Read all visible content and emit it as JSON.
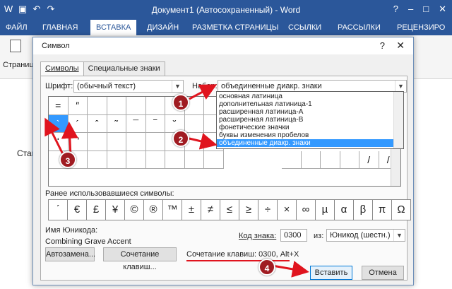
{
  "word": {
    "title": "Документ1 (Автосохраненный) - Word",
    "tabs": [
      "ФАЙЛ",
      "ГЛАВНАЯ",
      "ВСТАВКА",
      "ДИЗАЙН",
      "РАЗМЕТКА СТРАНИЦЫ",
      "ССЫЛКИ",
      "РАССЫЛКИ",
      "РЕЦЕНЗИРО"
    ],
    "ribbon_label": "Страниц",
    "doc_text": "Став"
  },
  "dialog": {
    "title": "Символ",
    "help": "?",
    "close": "✕",
    "tabs": [
      "Символы",
      "Специальные знаки"
    ],
    "font_label": "Шрифт:",
    "font_value": "(обычный текст)",
    "subset_label": "Набор:",
    "subset_value": "объединенные диакр. знаки",
    "subset_options": [
      "основная латиница",
      "дополнительная латиница-1",
      "расширенная латиница-A",
      "расширенная латиница-B",
      "фонетические значки",
      "буквы изменения пробелов",
      "объединенные диакр. знаки"
    ],
    "grid_rows": [
      [
        "=",
        "″",
        "",
        "",
        "",
        "",
        "",
        ""
      ],
      [
        "`",
        "´",
        "ˆ",
        "˜",
        "¯",
        "‾",
        "˘",
        ""
      ],
      [
        "ʻ",
        "̛",
        "",
        "",
        "",
        "",
        "",
        ""
      ],
      [
        "",
        "",
        "",
        "",
        "",
        "",
        "",
        ""
      ]
    ],
    "grid_row_right": [
      "/",
      "/"
    ],
    "recent_label": "Ранее использовавшиеся символы:",
    "recent": [
      "ˊ",
      "€",
      "£",
      "¥",
      "©",
      "®",
      "™",
      "±",
      "≠",
      "≤",
      "≥",
      "÷",
      "×",
      "∞",
      "µ",
      "α",
      "β",
      "π",
      "Ω"
    ],
    "unicode_name_label": "Имя Юникода:",
    "unicode_name": "Combining Grave Accent",
    "code_label": "Код знака:",
    "code_value": "0300",
    "from_label": "из:",
    "from_value": "Юникод (шестн.)",
    "autocorrect": "Автозамена...",
    "shortcut_key": "Сочетание клавиш...",
    "shortcut_text": "Сочетание клавиш: 0300, Alt+X",
    "insert": "Вставить",
    "cancel": "Отмена"
  },
  "badges": [
    "1",
    "2",
    "3",
    "4"
  ],
  "accent_color": "#e0141e",
  "selection_color": "#3399ff"
}
